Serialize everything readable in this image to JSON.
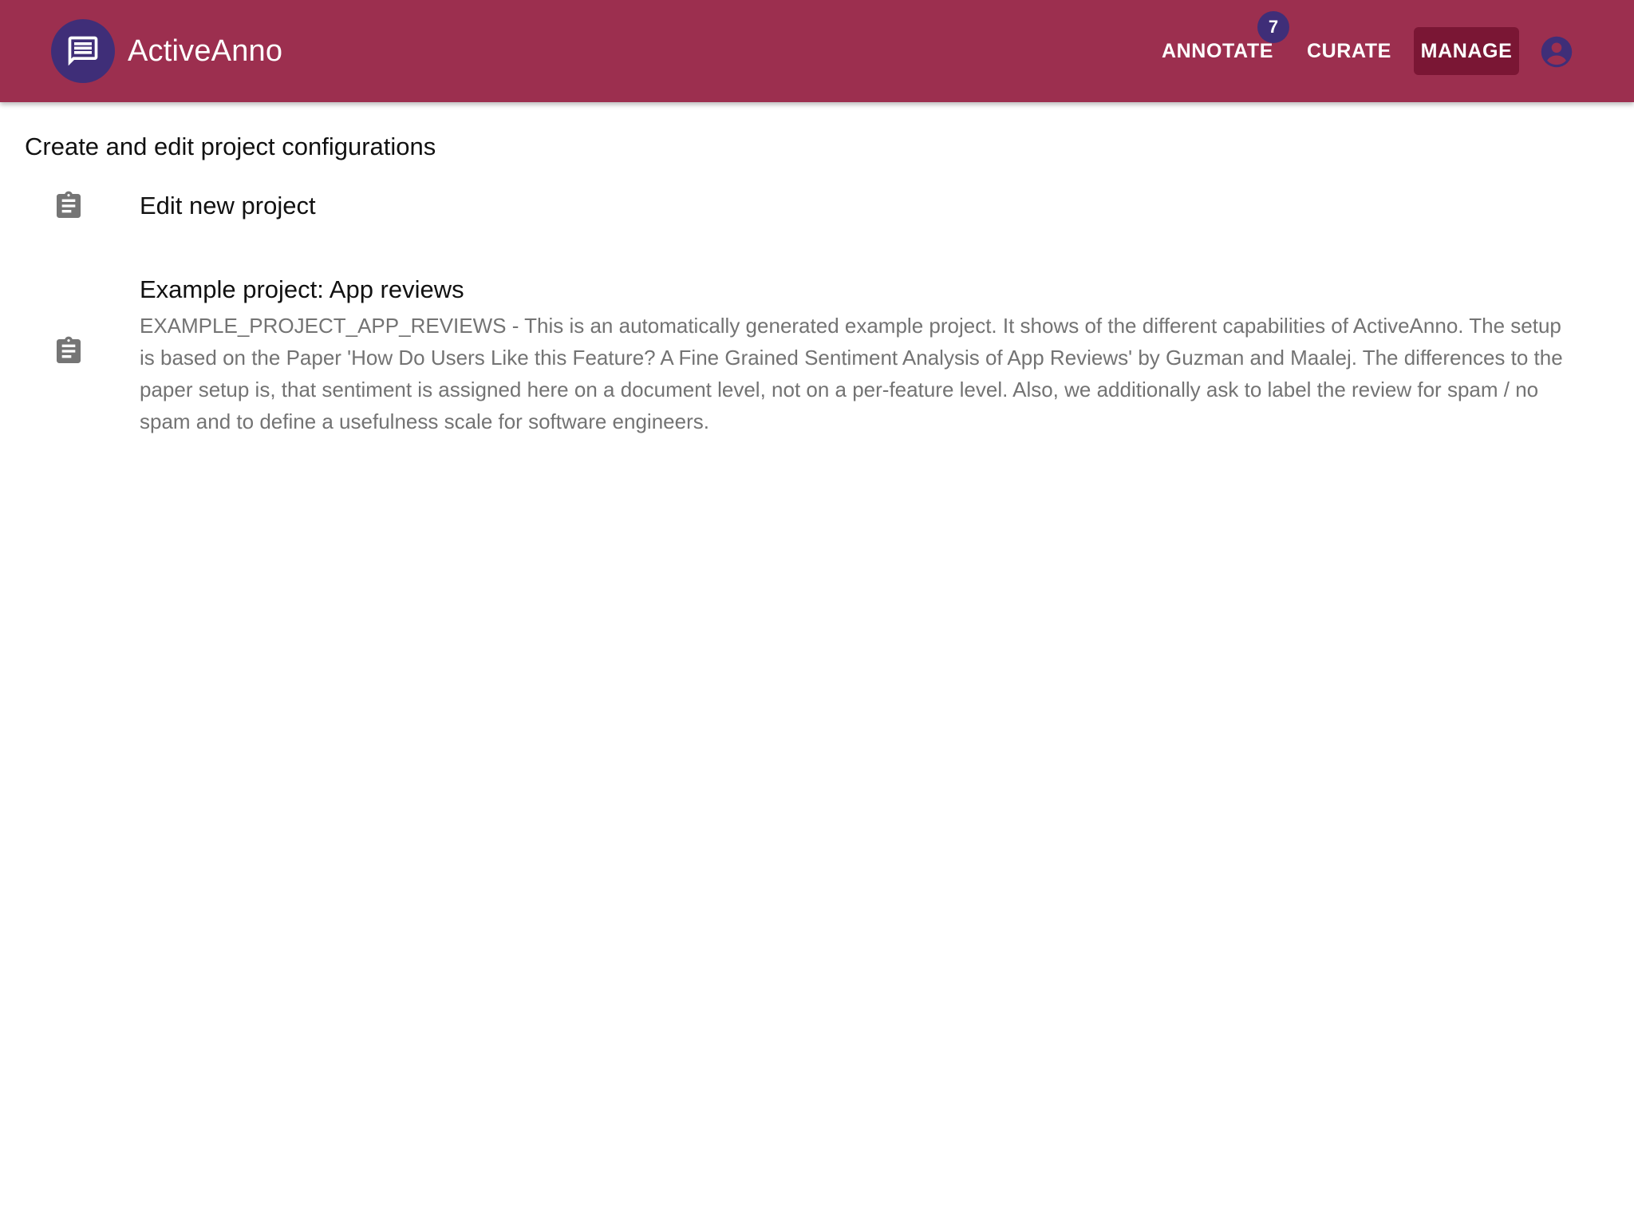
{
  "header": {
    "app_name": "ActiveAnno",
    "logo_icon": "chat-message-icon",
    "nav": {
      "annotate_label": "ANNOTATE",
      "annotate_badge": "7",
      "curate_label": "CURATE",
      "manage_label": "MANAGE",
      "active": "MANAGE"
    },
    "account_icon": "account-circle-icon"
  },
  "main": {
    "subtitle": "Create and edit project configurations",
    "projects": [
      {
        "icon": "clipboard-icon",
        "title": "Edit new project",
        "description": ""
      },
      {
        "icon": "clipboard-icon",
        "title": "Example project: App reviews",
        "description": "EXAMPLE_PROJECT_APP_REVIEWS - This is an automatically generated example project. It shows of the different capabilities of ActiveAnno. The setup is based on the Paper 'How Do Users Like this Feature? A Fine Grained Sentiment Analysis of App Reviews' by Guzman and Maalej. The differences to the paper setup is, that sentiment is assigned here on a document level, not on a per-feature level. Also, we additionally ask to label the review for spam / no spam and to define a usefulness scale for software engineers."
      }
    ]
  },
  "colors": {
    "appbar": "#9c2f4f",
    "accent": "#3f2e78",
    "active_nav": "#7a1634",
    "secondary_text": "#737373"
  }
}
